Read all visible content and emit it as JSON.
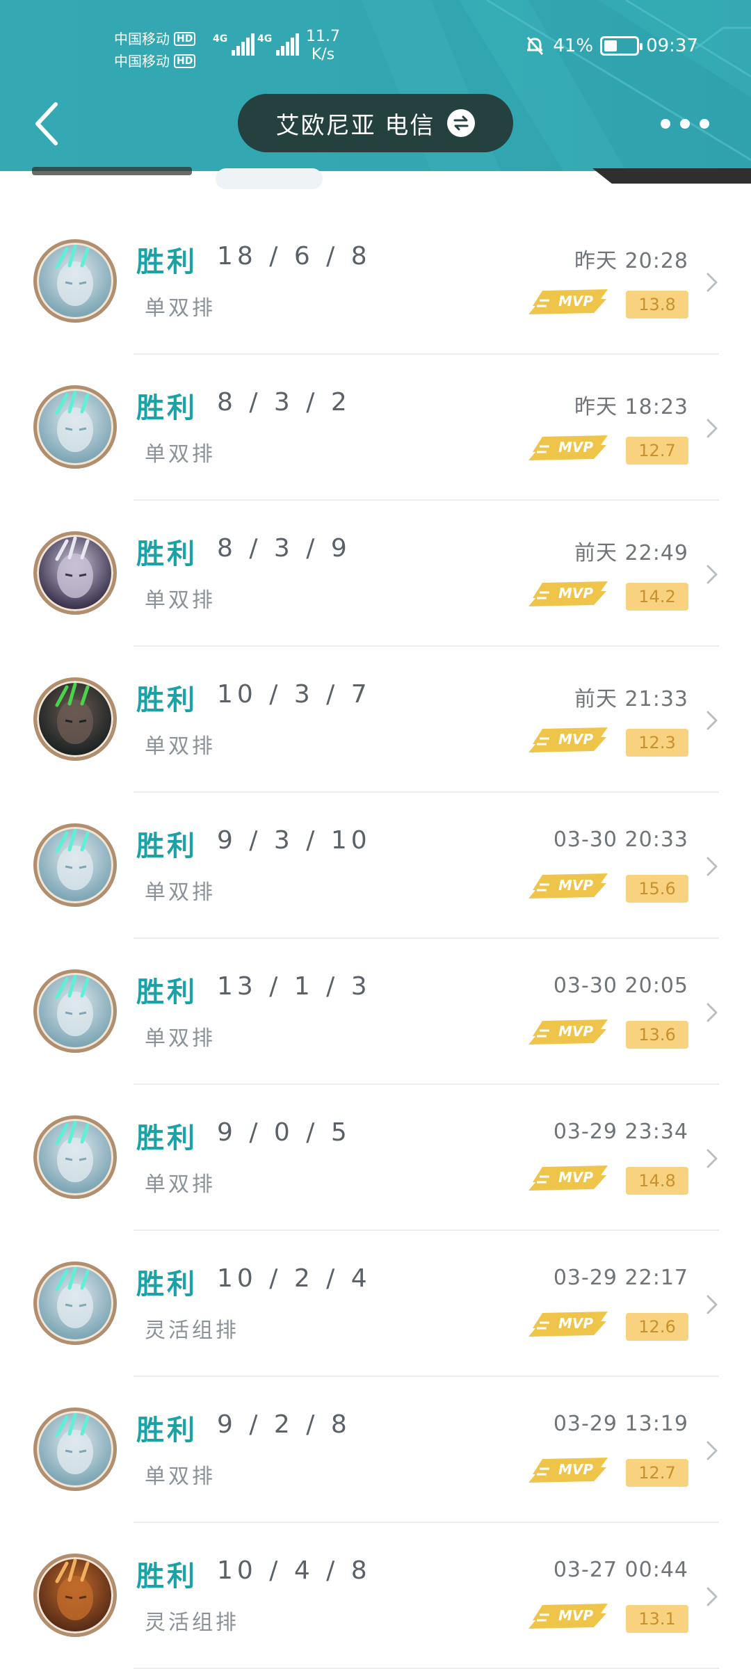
{
  "status_bar": {
    "carrier1": "中国移动",
    "carrier2": "中国移动",
    "hd": "HD",
    "net1": "4G",
    "net2": "4G",
    "speed_value": "11.7",
    "speed_unit": "K/s",
    "battery_percent": "41%",
    "battery_level": 0.41,
    "time": "09:37"
  },
  "header": {
    "title": "艾欧尼亚  电信",
    "back_icon": "back-chevron-icon",
    "swap_icon": "swap-icon",
    "more_icon": "more-dots-icon"
  },
  "colors": {
    "header_bg": "#34a9b3",
    "pill_bg": "#24403f",
    "win_text": "#1aa2a6",
    "score_bg": "#f8d27f",
    "mvp_gold": "#efc44a"
  },
  "matches": [
    {
      "result": "胜利",
      "kda": "18 / 6 / 8",
      "mode": "单双排",
      "time": "昨天 20:28",
      "score": "13.8",
      "badge": "MVP",
      "avatar": "champion-avatar-silver"
    },
    {
      "result": "胜利",
      "kda": "8 / 3 / 2",
      "mode": "单双排",
      "time": "昨天 18:23",
      "score": "12.7",
      "badge": "MVP",
      "avatar": "champion-avatar-silver"
    },
    {
      "result": "胜利",
      "kda": "8 / 3 / 9",
      "mode": "单双排",
      "time": "前天 22:49",
      "score": "14.2",
      "badge": "MVP",
      "avatar": "champion-avatar-purple"
    },
    {
      "result": "胜利",
      "kda": "10 / 3 / 7",
      "mode": "单双排",
      "time": "前天 21:33",
      "score": "12.3",
      "badge": "MVP",
      "avatar": "champion-avatar-dark"
    },
    {
      "result": "胜利",
      "kda": "9 / 3 / 10",
      "mode": "单双排",
      "time": "03-30 20:33",
      "score": "15.6",
      "badge": "MVP",
      "avatar": "champion-avatar-silver"
    },
    {
      "result": "胜利",
      "kda": "13 / 1 / 3",
      "mode": "单双排",
      "time": "03-30 20:05",
      "score": "13.6",
      "badge": "MVP",
      "avatar": "champion-avatar-silver"
    },
    {
      "result": "胜利",
      "kda": "9 / 0 / 5",
      "mode": "单双排",
      "time": "03-29 23:34",
      "score": "14.8",
      "badge": "MVP",
      "avatar": "champion-avatar-silver"
    },
    {
      "result": "胜利",
      "kda": "10 / 2 / 4",
      "mode": "灵活组排",
      "time": "03-29 22:17",
      "score": "12.6",
      "badge": "MVP",
      "avatar": "champion-avatar-silver"
    },
    {
      "result": "胜利",
      "kda": "9 / 2 / 8",
      "mode": "单双排",
      "time": "03-29 13:19",
      "score": "12.7",
      "badge": "MVP",
      "avatar": "champion-avatar-silver"
    },
    {
      "result": "胜利",
      "kda": "10 / 4 / 8",
      "mode": "灵活组排",
      "time": "03-27 00:44",
      "score": "13.1",
      "badge": "MVP",
      "avatar": "champion-avatar-bronze"
    }
  ]
}
